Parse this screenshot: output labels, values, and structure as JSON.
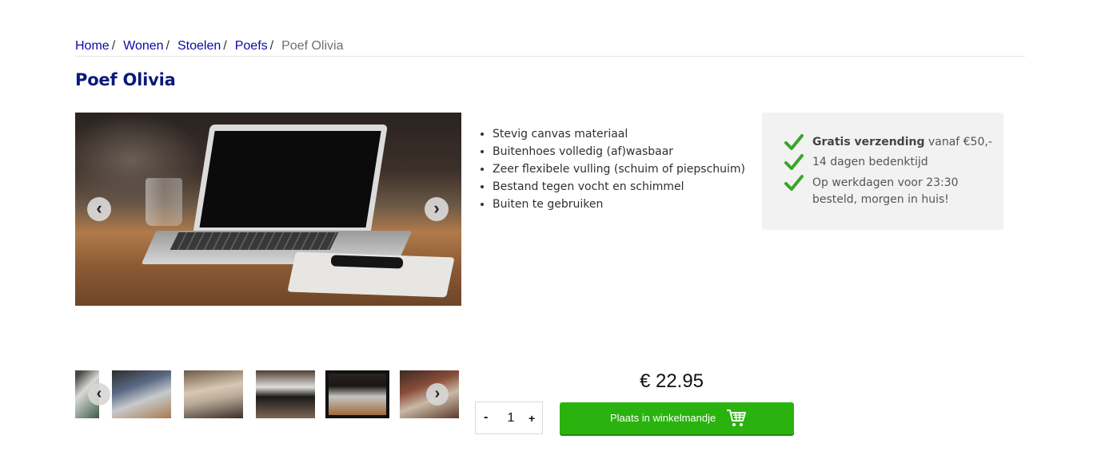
{
  "breadcrumb": {
    "items": [
      "Home",
      "Wonen",
      "Stoelen",
      "Poefs"
    ],
    "separator": "/",
    "current": "Poef Olivia"
  },
  "product": {
    "title": "Poef Olivia",
    "features": [
      "Stevig canvas materiaal",
      "Buitenhoes volledig (af)wasbaar",
      "Zeer flexibele vulling (schuim of piepschuim)",
      "Bestand tegen vocht en schimmel",
      "Buiten te gebruiken"
    ],
    "price": "€ 22.95",
    "quantity": "1",
    "qty_minus": "-",
    "qty_plus": "+",
    "add_to_cart": "Plaats in winkelmandje"
  },
  "usp": {
    "item1_bold": "Gratis verzending",
    "item1_rest": " vanaf €50,-",
    "item2": "14 dagen bedenktijd",
    "item3_line1": "Op werkdagen voor 23:30",
    "item3_line2": "besteld, morgen in huis!"
  },
  "gallery": {
    "prev_icon": "‹",
    "next_icon": "›",
    "thumbnail_count": 6,
    "active_thumbnail": 5
  },
  "colors": {
    "link": "#0a0aa8",
    "title": "#0b1a7a",
    "cart_button": "#2ab20e",
    "check": "#3aa52b",
    "usp_bg": "#f2f2f2"
  }
}
